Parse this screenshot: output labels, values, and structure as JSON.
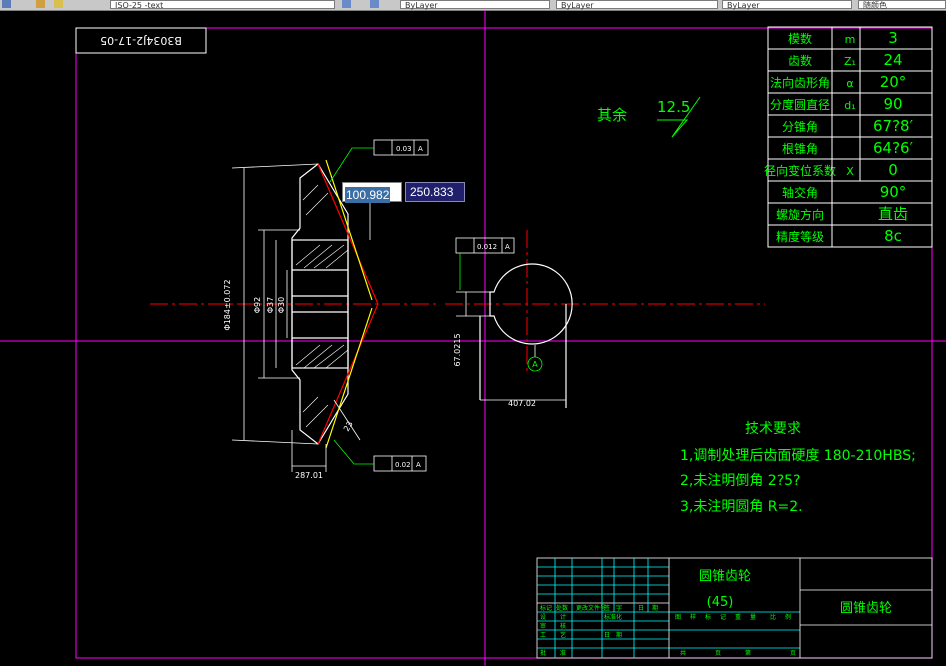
{
  "toolbar": {
    "combo_text": "ISO-25 -text",
    "layer_1": "ByLayer",
    "layer_2": "ByLayer",
    "layer_3": "ByLayer",
    "plot_style": "随颜色"
  },
  "drawing_number": "B3034J2-17-05",
  "params": [
    {
      "name": "模数",
      "sym": "m",
      "val": "3"
    },
    {
      "name": "齿数",
      "sym": "Z₁",
      "val": "24"
    },
    {
      "name": "法向齿形角",
      "sym": "α",
      "val": "20°"
    },
    {
      "name": "分度圆直径",
      "sym": "d₁",
      "val": "90"
    },
    {
      "name": "分锥角",
      "sym": "",
      "val": "67?8′"
    },
    {
      "name": "根锥角",
      "sym": "",
      "val": "64?6′"
    },
    {
      "name": "径向变位系数",
      "sym": "X",
      "val": "0"
    },
    {
      "name": "轴交角",
      "sym": "",
      "val": "90°"
    },
    {
      "name": "螺旋方向",
      "sym": "",
      "val": "直齿"
    },
    {
      "name": "精度等级",
      "sym": "",
      "val": "8c"
    }
  ],
  "roughness": {
    "label": "其余",
    "value": "12.5"
  },
  "tolerances": {
    "top_runout": "0.03",
    "bottom_runout": "0.02",
    "symmetry": "0.012",
    "datum": "A"
  },
  "dims": {
    "od1": "Φ184±0.072",
    "od2": "Φ92",
    "bore1": "Φ37",
    "bore2": "Φ30",
    "tooth_width": "23",
    "hub_len": "287.01",
    "keyway_h": "67.0215",
    "keyway_w": "407.02"
  },
  "tech_req": {
    "title": "技术要求",
    "items": [
      "1,调制处理后齿面硬度 180-210HBS;",
      "2,未注明倒角 2?5?",
      "3,未注明圆角 R=2."
    ]
  },
  "titleblock": {
    "part_name": "圆锥齿轮",
    "material": "(45)",
    "drawing_title": "圆锥齿轮",
    "hdr": [
      "标记",
      "处数",
      "更改文件号",
      "签",
      "字",
      "日",
      "期"
    ],
    "roles": [
      "设",
      "计",
      "标准化",
      "审",
      "核",
      "工",
      "艺",
      "日",
      "期",
      "批",
      "准"
    ],
    "stage": [
      "图",
      "样",
      "标",
      "记",
      "重",
      "量",
      "比",
      "例"
    ],
    "sheet": [
      "共",
      "页",
      "第",
      "页"
    ]
  },
  "dynamic_input": {
    "field1": "100.982",
    "field2": "250.833"
  },
  "colors": {
    "frame": "#ff00ff",
    "green": "#00ff00",
    "red": "#ff0000",
    "white": "#ffffff",
    "cyan": "#00ffff",
    "yellow": "#ffff00"
  }
}
